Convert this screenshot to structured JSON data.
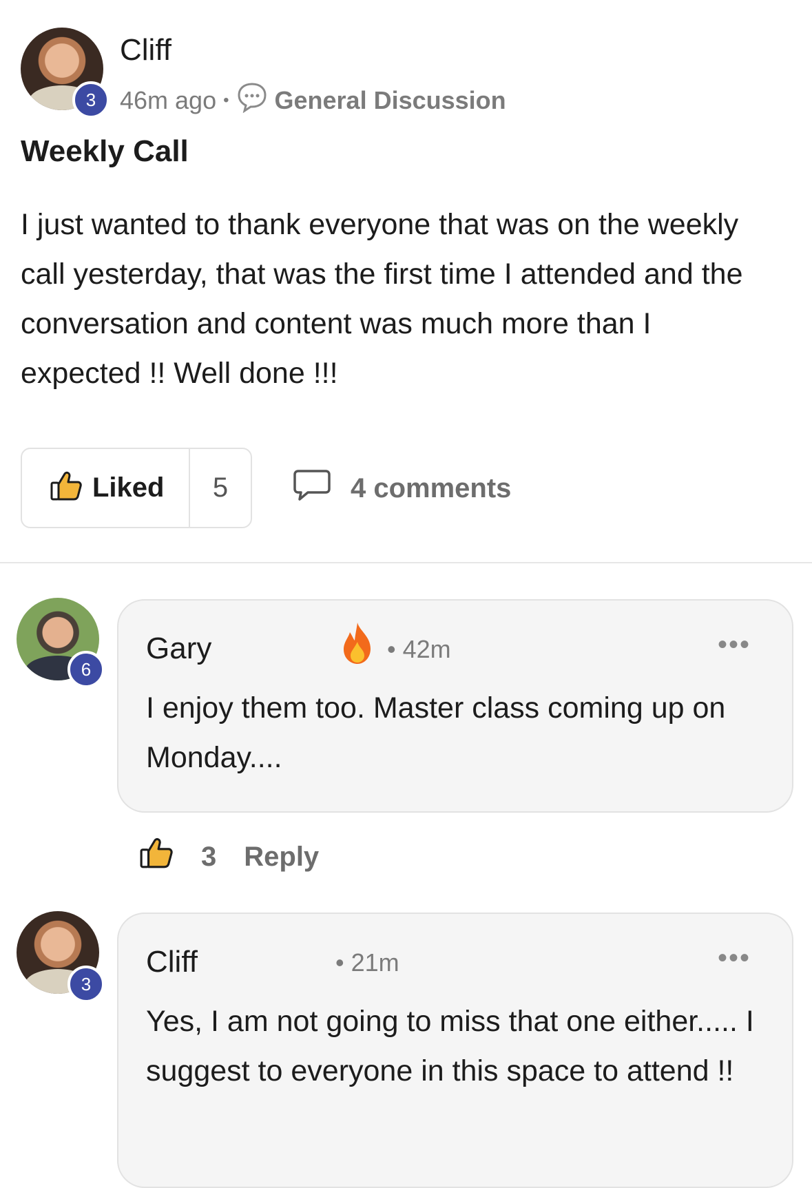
{
  "post": {
    "author": "Cliff",
    "level": "3",
    "time": "46m ago",
    "separator": "•",
    "category": "General Discussion",
    "title": "Weekly Call",
    "body": "I just wanted to thank everyone that was on the weekly call yesterday, that was the first time I attended and the conversation and content was much more than I expected !! Well done !!!",
    "like_label": "Liked",
    "like_count": "5",
    "comments_label": "4 comments"
  },
  "comments": [
    {
      "author": "Gary",
      "level": "6",
      "time": "• 42m",
      "text": "I enjoy them too. Master class coming up on Monday....",
      "likes": "3",
      "reply_label": "Reply",
      "more": "•••"
    },
    {
      "author": "Cliff",
      "level": "3",
      "time": "• 21m",
      "text": "Yes, I am not going to miss that one either..... I suggest to everyone in this space to attend !!",
      "more": "•••"
    }
  ],
  "colors": {
    "level_badge": "#3c4aa3",
    "bubble_bg": "#f5f5f5",
    "fire": "#f26a1b"
  },
  "icons": [
    "thumbs-up-icon",
    "comment-bubble-icon",
    "fire-icon",
    "more-icon"
  ]
}
